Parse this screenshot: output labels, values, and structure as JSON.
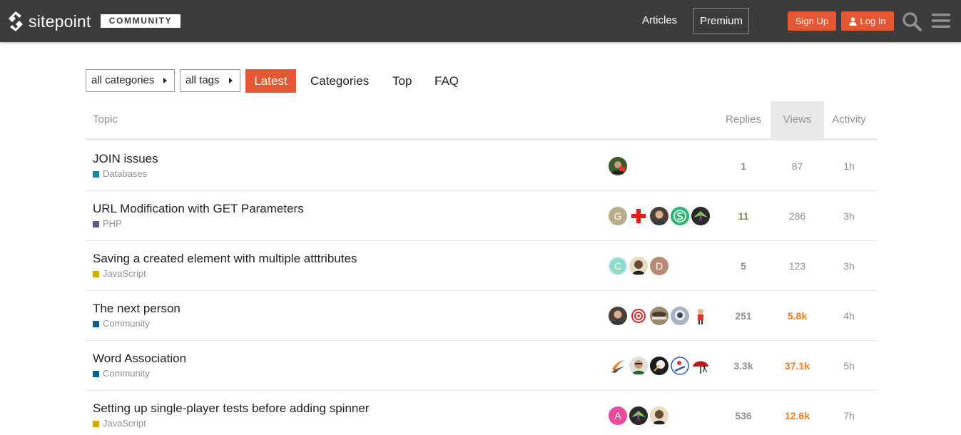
{
  "header": {
    "brand": "sitepoint",
    "badge": "COMMUNITY",
    "nav_articles": "Articles",
    "nav_premium": "Premium",
    "signup_label": "Sign Up",
    "login_label": "Log In",
    "colors": {
      "bar": "#3c3c3c",
      "accent": "#e45735"
    }
  },
  "filters": {
    "categories_label": "all categories",
    "tags_label": "all tags"
  },
  "nav": {
    "latest": "Latest",
    "categories": "Categories",
    "top": "Top",
    "faq": "FAQ"
  },
  "table": {
    "headers": {
      "topic": "Topic",
      "replies": "Replies",
      "views": "Views",
      "activity": "Activity"
    },
    "rows": [
      {
        "title": "JOIN issues",
        "category": "Databases",
        "category_color": "#1f85a1",
        "replies": "1",
        "views": "87",
        "activity": "1h",
        "posters": [
          "photo-avatar-green"
        ]
      },
      {
        "title": "URL Modification with GET Parameters",
        "category": "PHP",
        "category_color": "#5b5b85",
        "replies": "11",
        "views": "286",
        "activity": "3h",
        "posters": [
          "letter-G",
          "red-cross-avatar",
          "photo-avatar-man",
          "green-s-avatar",
          "dark-logo-avatar"
        ]
      },
      {
        "title": "Saving a created element with multiple atttributes",
        "category": "JavaScript",
        "category_color": "#d6a900",
        "replies": "5",
        "views": "123",
        "activity": "3h",
        "posters": [
          "letter-C",
          "photo-avatar-bald",
          "letter-D"
        ]
      },
      {
        "title": "The next person",
        "category": "Community",
        "category_color": "#0e5f8a",
        "replies": "251",
        "views": "5.8k",
        "activity": "4h",
        "posters": [
          "photo-avatar-man",
          "target-avatar",
          "hat-avatar",
          "astronaut-avatar",
          "cartoon-avatar"
        ]
      },
      {
        "title": "Word Association",
        "category": "Community",
        "category_color": "#0e5f8a",
        "replies": "3.3k",
        "views": "37.1k",
        "activity": "5h",
        "posters": [
          "swoosh-avatar",
          "photo-avatar-glasses",
          "dark-moon-avatar",
          "skier-avatar",
          "red-umbrella-avatar"
        ]
      },
      {
        "title": "Setting up single-player tests before adding spinner",
        "category": "JavaScript",
        "category_color": "#d6a900",
        "replies": "536",
        "views": "12.6k",
        "activity": "7h",
        "posters": [
          "letter-A",
          "dark-logo-avatar",
          "photo-avatar-bald"
        ]
      }
    ]
  }
}
